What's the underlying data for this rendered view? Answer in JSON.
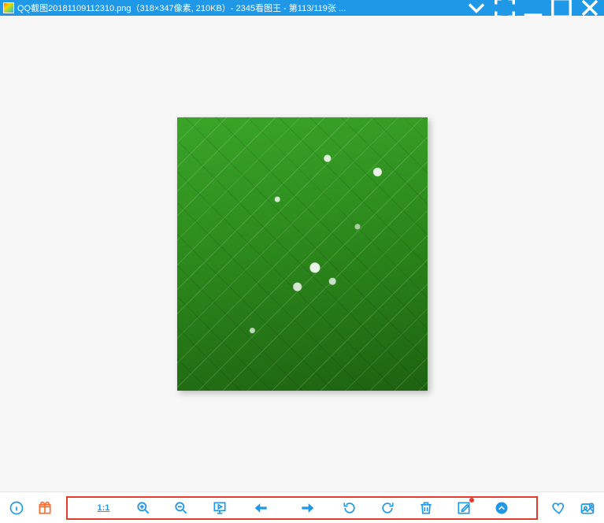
{
  "titlebar": {
    "title": "QQ截图20181109112310.png（318×347像素, 210KB）- 2345看图王 - 第113/119张 ..."
  },
  "image": {
    "filename": "QQ截图20181109112310.png",
    "dimensions": "318×347像素",
    "filesize": "210KB",
    "app_name": "2345看图王",
    "index": "113",
    "total": "119"
  },
  "toolbar": {
    "ratio_label": "1:1"
  }
}
